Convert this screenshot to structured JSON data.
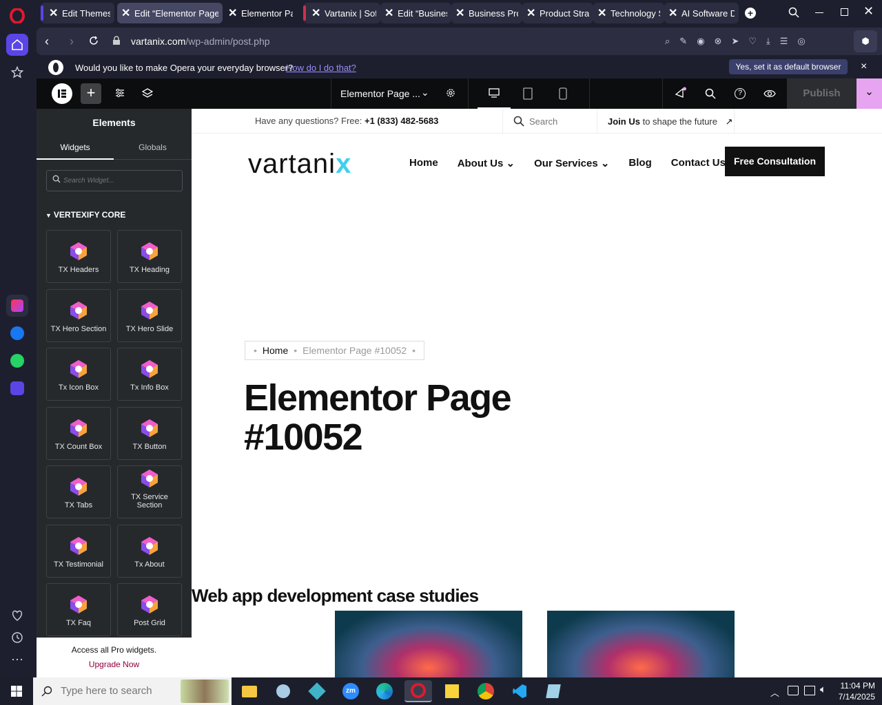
{
  "browser": {
    "tabs": [
      {
        "label": "Edit Themes ‹"
      },
      {
        "label": "Edit “Elementor Page #"
      },
      {
        "label": "Elementor Pag"
      },
      {
        "label": "Vartanix | Soft"
      },
      {
        "label": "Edit “Business"
      },
      {
        "label": "Business Proc"
      },
      {
        "label": "Product Strate"
      },
      {
        "label": "Technology St"
      },
      {
        "label": "AI Software D"
      }
    ],
    "url_domain": "vartanix.com",
    "url_path": "/wp-admin/post.php",
    "banner_text": "Would you like to make Opera your everyday browser?",
    "banner_link": "How do I do that?",
    "banner_button": "Yes, set it as default browser",
    "banner_close": "×"
  },
  "elementor": {
    "page_title": "Elementor Page ...",
    "publish_label": "Publish",
    "panel_title": "Elements",
    "tabs": [
      "Widgets",
      "Globals"
    ],
    "search_placeholder": "Search Widget...",
    "category": "VERTEXIFY CORE",
    "widgets": [
      "TX Headers",
      "TX Heading",
      "TX Hero Section",
      "TX Hero Slide",
      "Tx Icon Box",
      "Tx Info Box",
      "TX Count Box",
      "TX Button",
      "TX Tabs",
      "TX Service Section",
      "TX Testimonial",
      "Tx About",
      "TX Faq",
      "Post Grid"
    ],
    "pro_text": "Access all Pro widgets.",
    "pro_link": "Upgrade Now"
  },
  "site": {
    "topbar_question": "Have any questions? Free: ",
    "topbar_phone": "+1 (833) 482-5683",
    "search_placeholder": "Search",
    "join_bold": "Join Us",
    "join_rest": " to shape the future",
    "logo_text": "vartani",
    "nav": [
      "Home",
      "About Us",
      "Our Services",
      "Blog",
      "Contact Us"
    ],
    "cta": "Free Consultation",
    "breadcrumb_home": "Home",
    "breadcrumb_current": "Elementor Page #10052",
    "heading_line1": "Elementor Page",
    "heading_line2": "#10052",
    "section_title": "Web app development case studies"
  },
  "taskbar": {
    "search_placeholder": "Type here to search",
    "time": "11:04 PM",
    "date": "7/14/2025"
  },
  "colors": {
    "opera_red": "#e0192f",
    "banner_button": "#3b3f6b",
    "publish_accent": "#e7a4f0",
    "cta_bg": "#111111",
    "logo_x": "#3fd0f0"
  }
}
